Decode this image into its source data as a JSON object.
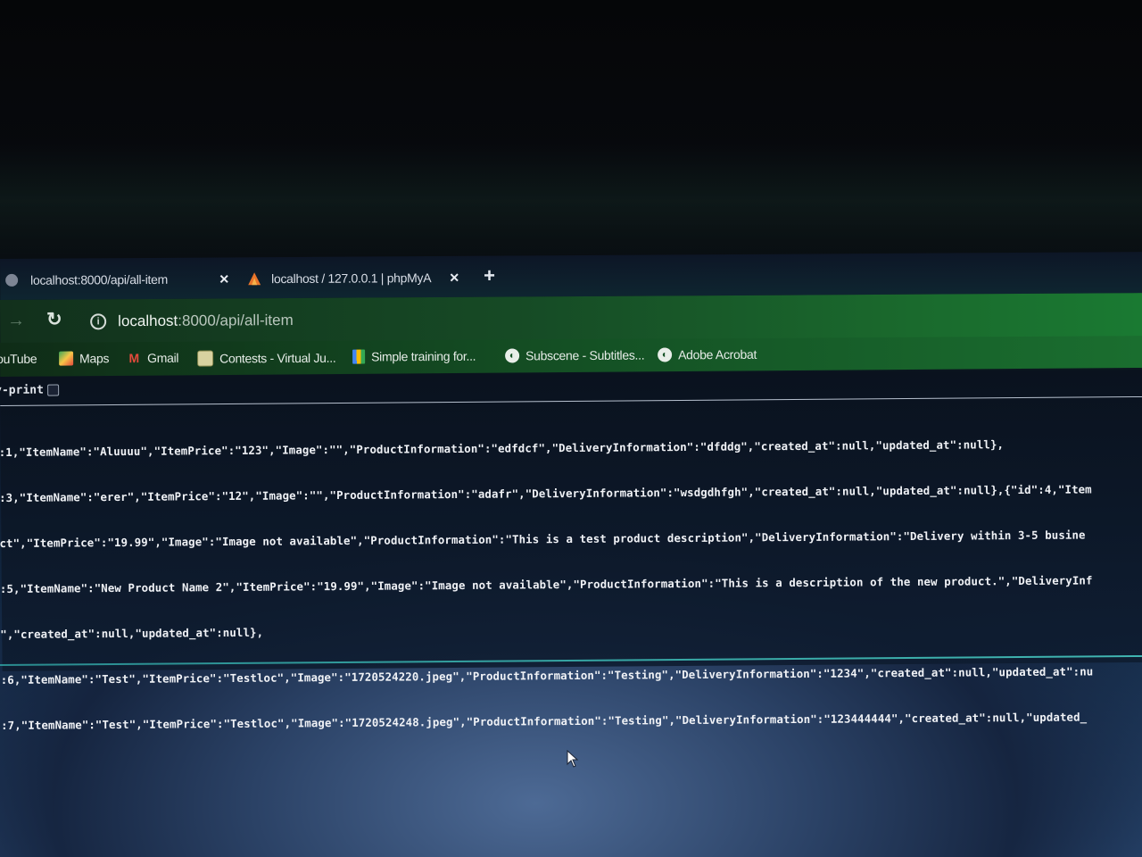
{
  "tabs": [
    {
      "title": "localhost:8000/api/all-item",
      "close": "×"
    },
    {
      "title": "localhost / 127.0.0.1 | phpMyA",
      "close": "×"
    }
  ],
  "new_tab": "+",
  "address_bar": {
    "host": "localhost",
    "path": ":8000/api/all-item"
  },
  "bookmarks": [
    {
      "label": "ouTube",
      "icon": "youtube-icon"
    },
    {
      "label": "Maps",
      "icon": "maps-icon"
    },
    {
      "label": "Gmail",
      "icon": "gmail-icon"
    },
    {
      "label": "Contests - Virtual Ju...",
      "icon": "contests-icon"
    },
    {
      "label": "Simple training for...",
      "icon": "chart-icon"
    },
    {
      "label": "Subscene - Subtitles...",
      "icon": "globe-icon"
    },
    {
      "label": "Adobe Acrobat",
      "icon": "globe-icon"
    }
  ],
  "pretty_print_label": "y-print",
  "json_lines": [
    ":1,\"ItemName\":\"Aluuuu\",\"ItemPrice\":\"123\",\"Image\":\"\",\"ProductInformation\":\"edfdcf\",\"DeliveryInformation\":\"dfddg\",\"created_at\":null,\"updated_at\":null},",
    ":3,\"ItemName\":\"erer\",\"ItemPrice\":\"12\",\"Image\":\"\",\"ProductInformation\":\"adafr\",\"DeliveryInformation\":\"wsdgdhfgh\",\"created_at\":null,\"updated_at\":null},{\"id\":4,\"Item",
    "ct\",\"ItemPrice\":\"19.99\",\"Image\":\"Image not available\",\"ProductInformation\":\"This is a test product description\",\"DeliveryInformation\":\"Delivery within 3-5 busine",
    ":5,\"ItemName\":\"New Product Name 2\",\"ItemPrice\":\"19.99\",\"Image\":\"Image not available\",\"ProductInformation\":\"This is a description of the new product.\",\"DeliveryInf",
    "\",\"created_at\":null,\"updated_at\":null},",
    ":6,\"ItemName\":\"Test\",\"ItemPrice\":\"Testloc\",\"Image\":\"1720524220.jpeg\",\"ProductInformation\":\"Testing\",\"DeliveryInformation\":\"1234\",\"created_at\":null,\"updated_at\":nu",
    ":7,\"ItemName\":\"Test\",\"ItemPrice\":\"Testloc\",\"Image\":\"1720524248.jpeg\",\"ProductInformation\":\"Testing\",\"DeliveryInformation\":\"123444444\",\"created_at\":null,\"updated_"
  ]
}
